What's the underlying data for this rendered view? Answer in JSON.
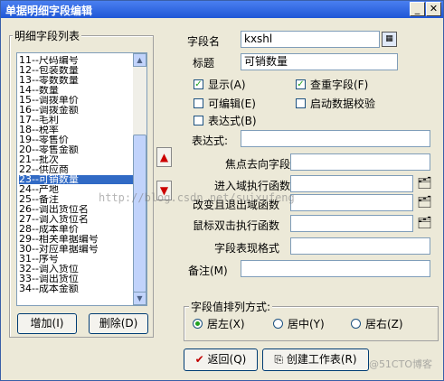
{
  "window": {
    "title": "单据明细字段编辑",
    "controls": [
      "minimize-icon",
      "close-icon"
    ]
  },
  "field_list": {
    "group_label": "明细字段列表",
    "items": [
      "11--尺码编号",
      "12--包装数量",
      "13--零数数量",
      "14--数量",
      "15--调拨单价",
      "16--调拨金额",
      "17--毛利",
      "18--税率",
      "19--零售价",
      "20--零售金额",
      "21--批次",
      "22--供应商",
      "23--可销数量",
      "24--产地",
      "25--备注",
      "26--调出货位名",
      "27--调入货位名",
      "28--成本单价",
      "29--相关单据编号",
      "30--对应单据编号",
      "31--序号",
      "32--调入货位",
      "33--调出货位",
      "34--成本金额"
    ],
    "selected_index": 12,
    "add_button": "增加(I)",
    "delete_button": "删除(D)"
  },
  "form": {
    "field_name_label": "字段名",
    "field_name_value": "kxshl",
    "title_label": "标题",
    "title_value": "可销数量",
    "show_label": "显示(A)",
    "show_checked": true,
    "lookup_label": "查重字段(F)",
    "lookup_checked": true,
    "editable_label": "可编辑(E)",
    "editable_checked": false,
    "validate_label": "启动数据校验",
    "validate_checked": false,
    "expression_check_label": "表达式(B)",
    "expression_checked": false,
    "expression_label": "表达式:",
    "expression_value": "",
    "focus_field_label": "焦点去向字段",
    "focus_field_value": "",
    "enter_func_label": "进入域执行函数",
    "enter_func_value": "",
    "exit_func_label": "改变且退出域函数",
    "exit_func_value": "",
    "dblclick_func_label": "鼠标双击执行函数",
    "dblclick_func_value": "",
    "format_label": "字段表现格式",
    "format_value": "",
    "remark_label": "备注(M)",
    "remark_value": ""
  },
  "alignment": {
    "group_label": "字段值排列方式:",
    "options": [
      "居左(X)",
      "居中(Y)",
      "居右(Z)"
    ],
    "selected": 0
  },
  "buttons": {
    "back": "返回(Q)",
    "create_sheet": "创建工作表(R)"
  },
  "watermark_text": "http://blog.csdn.net/suixufeng",
  "logo_text": "@51CTO博客",
  "colors": {
    "title_bar": "#1f57d6",
    "selection": "#316ac5",
    "check_mark": "#21a121",
    "arrow_red": "#cc0000"
  }
}
